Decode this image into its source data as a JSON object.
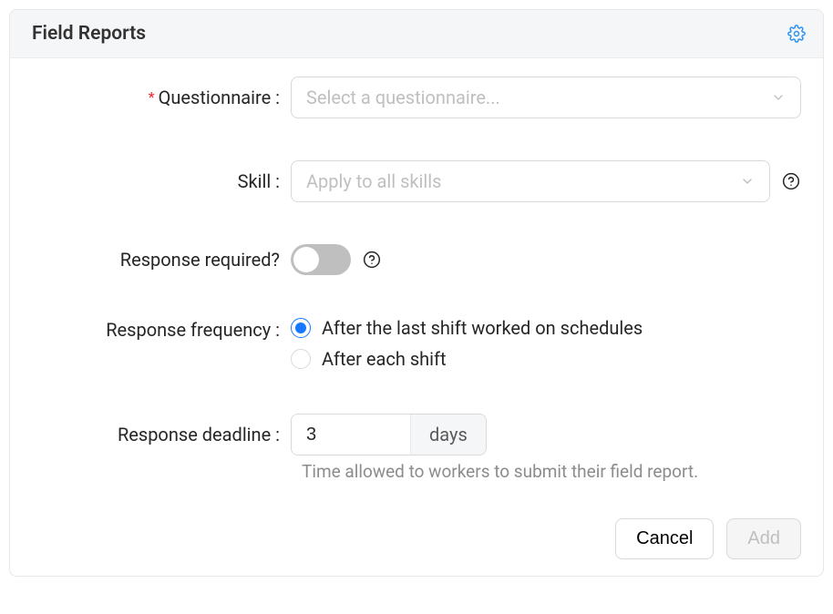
{
  "header": {
    "title": "Field Reports"
  },
  "fields": {
    "questionnaire": {
      "label": "Questionnaire :",
      "required_mark": "*",
      "placeholder": "Select a questionnaire..."
    },
    "skill": {
      "label": "Skill :",
      "placeholder": "Apply to all skills"
    },
    "response_required": {
      "label": "Response required?",
      "value": false
    },
    "response_frequency": {
      "label": "Response frequency :",
      "options": [
        {
          "label": "After the last shift worked on schedules",
          "selected": true
        },
        {
          "label": "After each shift",
          "selected": false
        }
      ]
    },
    "response_deadline": {
      "label": "Response deadline :",
      "value": "3",
      "unit": "days",
      "help": "Time allowed to workers to submit their field report."
    }
  },
  "footer": {
    "cancel": "Cancel",
    "add": "Add"
  }
}
